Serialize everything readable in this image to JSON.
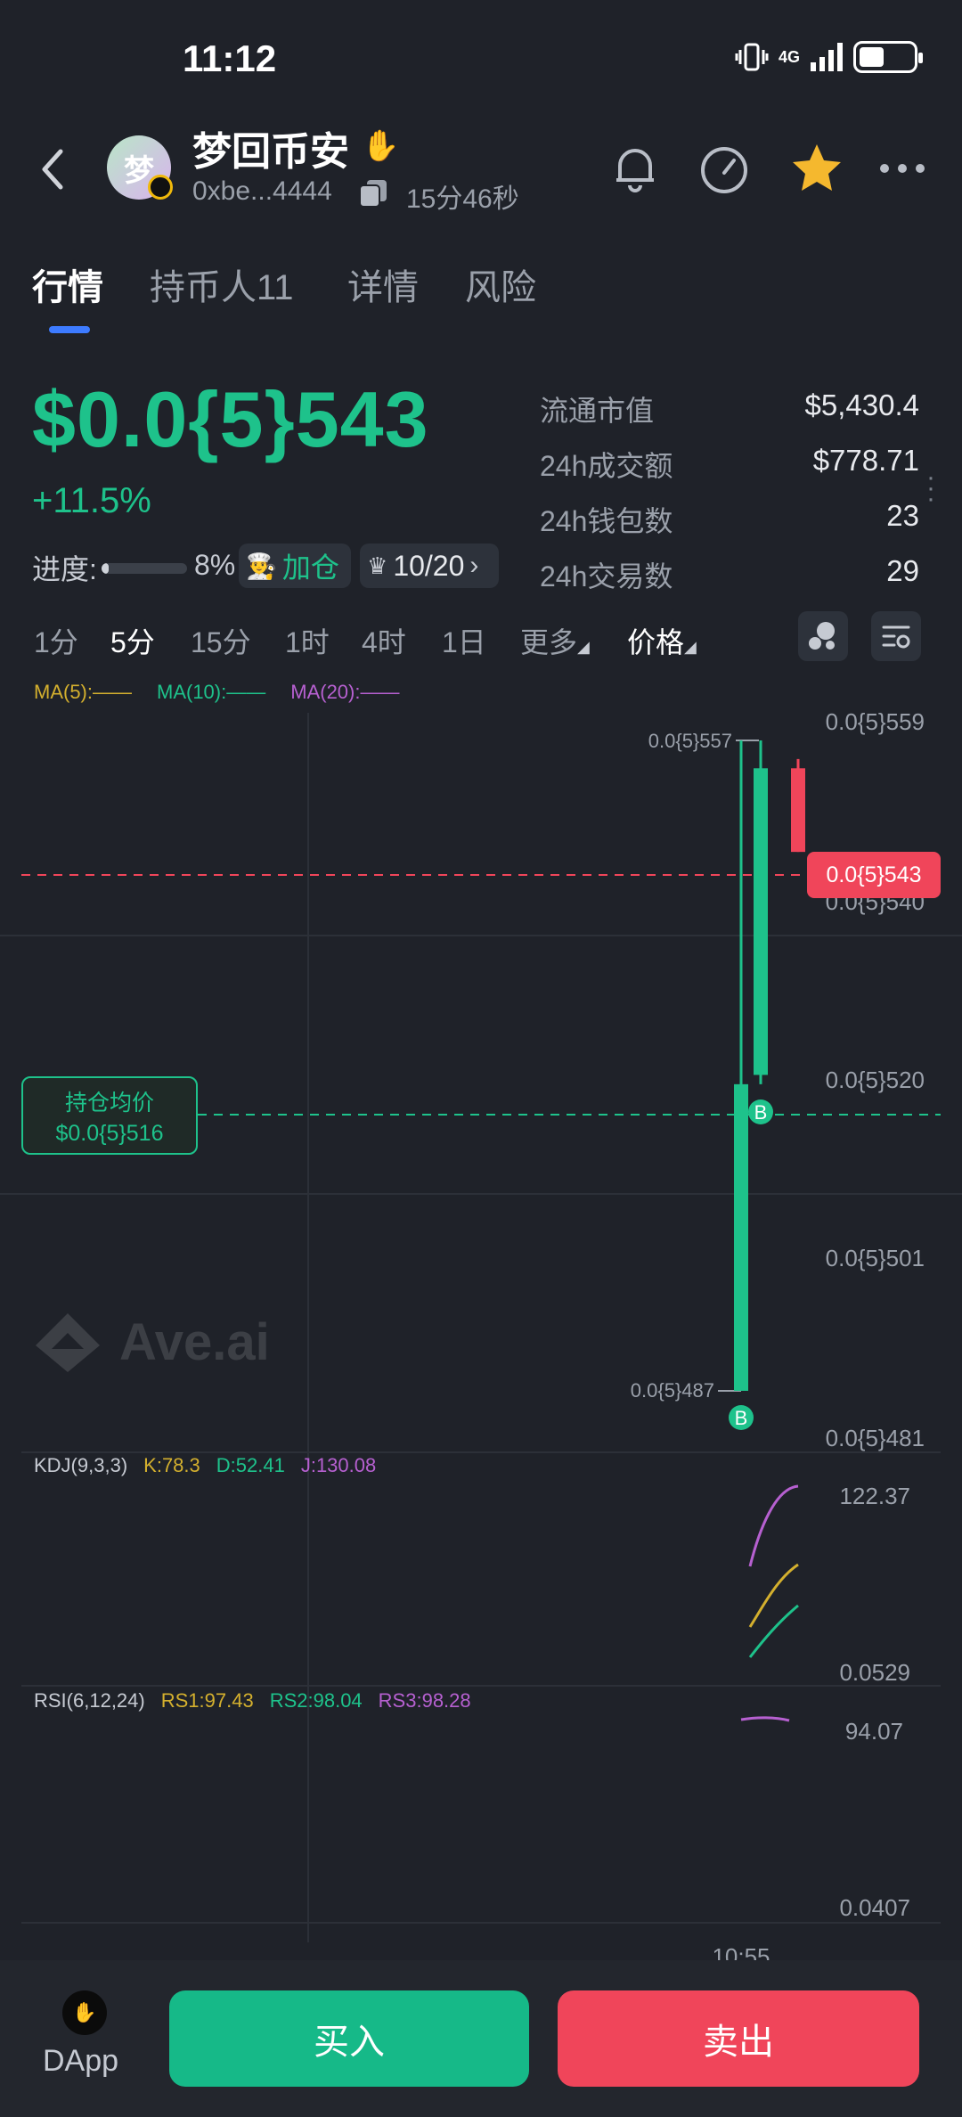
{
  "status_bar": {
    "time": "11:12",
    "network": "4G",
    "battery_level": 0.45
  },
  "header": {
    "avatar_text": "梦",
    "token_name": "梦回币安",
    "address": "0xbe...4444",
    "age": "15分46秒",
    "icons": [
      "back-icon",
      "copy-icon",
      "bell-icon",
      "gauge-icon",
      "star-icon",
      "more-icon"
    ],
    "star_color": "#f5b82e"
  },
  "tabs": [
    {
      "label": "行情",
      "active": true
    },
    {
      "label": "持币人11",
      "active": false
    },
    {
      "label": "详情",
      "active": false
    },
    {
      "label": "风险",
      "active": false
    }
  ],
  "price": {
    "value": "$0.0{5}543",
    "change": "+11.5%",
    "progress_label": "进度:",
    "progress_value": "8%",
    "progress_fraction": 0.08,
    "add_position_label": "加仓",
    "rank": "10/20",
    "color_up": "#1ec28b",
    "color_down": "#f0455a"
  },
  "stats": [
    {
      "label": "流通市值",
      "value": "$5,430.4"
    },
    {
      "label": "24h成交额",
      "value": "$778.71"
    },
    {
      "label": "24h钱包数",
      "value": "23"
    },
    {
      "label": "24h交易数",
      "value": "29"
    }
  ],
  "timeframes": {
    "items": [
      "1分",
      "5分",
      "15分",
      "1时",
      "4时",
      "1日"
    ],
    "active": "5分",
    "more_label": "更多",
    "price_label": "价格"
  },
  "chart": {
    "ma_legend": [
      "MA(5):——",
      "MA(10):——",
      "MA(20):——"
    ],
    "y_axis_labels": [
      "0.0{5}559",
      "0.0{5}540",
      "0.0{5}520",
      "0.0{5}501",
      "0.0{5}481"
    ],
    "high_label": "0.0{5}557",
    "low_label": "0.0{5}487",
    "current_price_tag": "0.0{5}543",
    "avg_title": "持仓均价",
    "avg_value": "$0.0{5}516",
    "trade_marker": "B",
    "watermark": "Ave.ai",
    "time_label": "10:55"
  },
  "chart_data": {
    "type": "candlestick",
    "ylim": [
      4.81e-06,
      5.59e-06
    ],
    "candles": [
      {
        "open": 5.2e-06,
        "high": 5.57e-06,
        "low": 4.87e-06,
        "close": 4.87e-06,
        "direction": "up"
      },
      {
        "open": 5.21e-06,
        "high": 5.57e-06,
        "low": 5.2e-06,
        "close": 5.54e-06,
        "direction": "up"
      },
      {
        "open": 5.54e-06,
        "high": 5.55e-06,
        "low": 5.45e-06,
        "close": 5.45e-06,
        "direction": "down"
      }
    ],
    "markers": [
      {
        "label": "B",
        "price": 4.87e-06
      },
      {
        "label": "B",
        "price": 5.16e-06
      }
    ],
    "lines": {
      "current_price": 5.43e-06,
      "avg_cost": 5.16e-06
    }
  },
  "kdj": {
    "title": "KDJ(9,3,3)",
    "k": "K:78.3",
    "d": "D:52.41",
    "j": "J:130.08",
    "y_top": "122.37",
    "y_bottom": "0.0529"
  },
  "rsi": {
    "title": "RSI(6,12,24)",
    "rs1": "RS1:97.43",
    "rs2": "RS2:98.04",
    "rs3": "RS3:98.28",
    "y_top": "94.07",
    "y_bottom": "0.0407"
  },
  "bottom_bar": {
    "dapp_label": "DApp",
    "buy_label": "买入",
    "sell_label": "卖出"
  }
}
